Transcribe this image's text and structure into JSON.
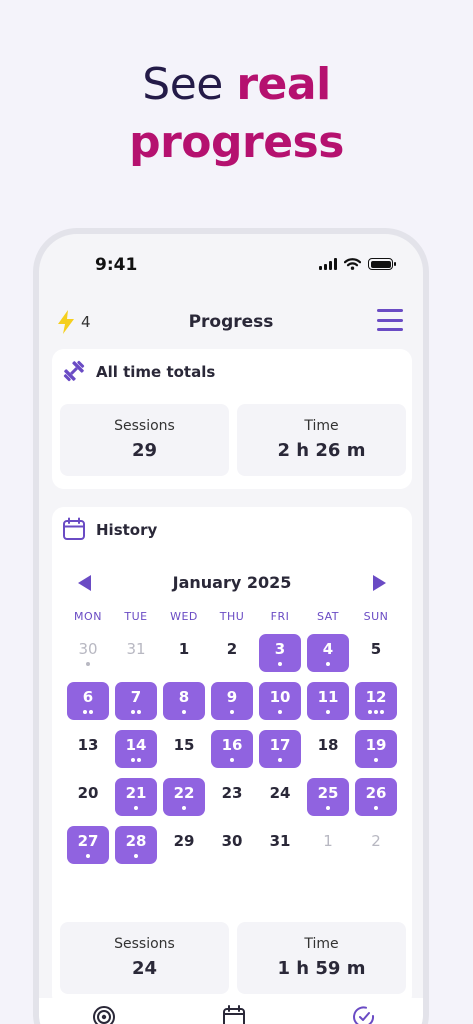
{
  "headline": {
    "part1": "See ",
    "part2": "real",
    "part3": "progress"
  },
  "status_bar": {
    "time": "9:41"
  },
  "header": {
    "streak": "4",
    "title": "Progress"
  },
  "totals": {
    "title": "All time totals",
    "sessions_label": "Sessions",
    "sessions_value": "29",
    "time_label": "Time",
    "time_value": "2 h 26 m"
  },
  "history": {
    "title": "History",
    "month": "January 2025",
    "weekdays": [
      "MON",
      "TUE",
      "WED",
      "THU",
      "FRI",
      "SAT",
      "SUN"
    ],
    "days": [
      {
        "label": "30",
        "muted": true,
        "dots": 1
      },
      {
        "label": "31",
        "muted": true,
        "dots": 0
      },
      {
        "label": "1",
        "dots": 0
      },
      {
        "label": "2",
        "dots": 0
      },
      {
        "label": "3",
        "active": true,
        "dots": 1
      },
      {
        "label": "4",
        "active": true,
        "dots": 1
      },
      {
        "label": "5",
        "dots": 0
      },
      {
        "label": "6",
        "active": true,
        "dots": 2
      },
      {
        "label": "7",
        "active": true,
        "dots": 2
      },
      {
        "label": "8",
        "active": true,
        "dots": 1
      },
      {
        "label": "9",
        "active": true,
        "dots": 1
      },
      {
        "label": "10",
        "active": true,
        "dots": 1
      },
      {
        "label": "11",
        "active": true,
        "dots": 1
      },
      {
        "label": "12",
        "active": true,
        "dots": 3
      },
      {
        "label": "13",
        "dots": 0
      },
      {
        "label": "14",
        "active": true,
        "dots": 2
      },
      {
        "label": "15",
        "dots": 0
      },
      {
        "label": "16",
        "active": true,
        "dots": 1
      },
      {
        "label": "17",
        "active": true,
        "dots": 1
      },
      {
        "label": "18",
        "dots": 0
      },
      {
        "label": "19",
        "active": true,
        "dots": 1
      },
      {
        "label": "20",
        "dots": 0
      },
      {
        "label": "21",
        "active": true,
        "dots": 1
      },
      {
        "label": "22",
        "active": true,
        "dots": 1
      },
      {
        "label": "23",
        "dots": 0
      },
      {
        "label": "24",
        "dots": 0
      },
      {
        "label": "25",
        "active": true,
        "dots": 1
      },
      {
        "label": "26",
        "active": true,
        "dots": 1
      },
      {
        "label": "27",
        "active": true,
        "dots": 1
      },
      {
        "label": "28",
        "active": true,
        "dots": 1
      },
      {
        "label": "29",
        "dots": 0
      },
      {
        "label": "30",
        "dots": 0
      },
      {
        "label": "31",
        "dots": 0
      },
      {
        "label": "1",
        "muted": true,
        "dots": 0
      },
      {
        "label": "2",
        "muted": true,
        "dots": 0
      }
    ],
    "sessions_label": "Sessions",
    "sessions_value": "24",
    "time_label": "Time",
    "time_value": "1 h 59 m"
  },
  "colors": {
    "accent": "#6a4bc4",
    "active_day": "#9063e0",
    "headline_accent": "#b5116f"
  },
  "icons": {
    "streak": "lightning-bolt-icon",
    "totals": "dumbbell-icon",
    "history": "calendar-icon",
    "tab1": "target-icon",
    "tab2": "calendar-icon",
    "tab3": "check-clock-icon"
  }
}
